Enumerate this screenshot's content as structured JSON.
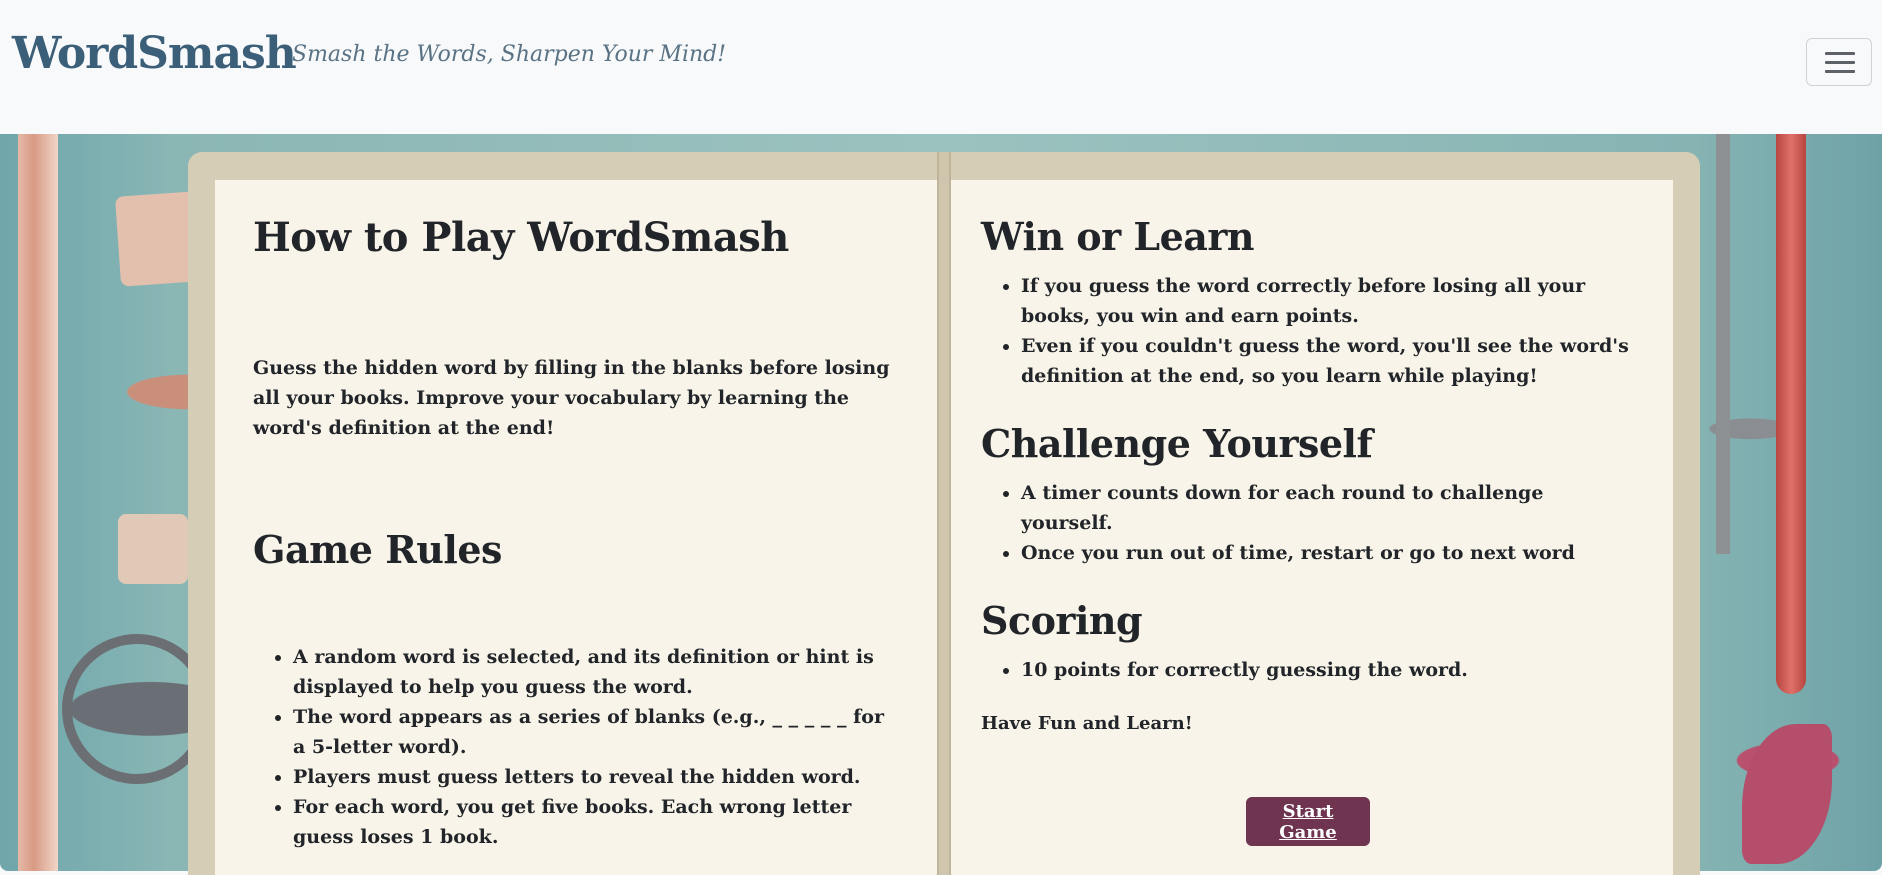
{
  "navbar": {
    "brand": "WordSmash",
    "tagline": "Smash the Words, Sharpen Your Mind!",
    "toggle_icon": "hamburger-menu-icon"
  },
  "colors": {
    "brand": "#3b5f78",
    "page": "#f8f4e9",
    "book_frame": "#d6cdb6",
    "button": "#6e3450"
  },
  "left_page": {
    "title": "How to Play WordSmash",
    "intro": "Guess the hidden word by filling in the blanks before losing all your books. Improve your vocabulary by learning the word's definition at the end!",
    "rules_title": "Game Rules",
    "rules": [
      "A random word is selected, and its definition or hint is displayed to help you guess the word.",
      "The word appears as a series of blanks (e.g., _ _ _ _ _ for a 5-letter word).",
      "Players must guess letters to reveal the hidden word.",
      "For each word, you get five books. Each wrong letter guess loses 1 book."
    ]
  },
  "right_page": {
    "win_title": "Win or Learn",
    "win_items": [
      "If you guess the word correctly before losing all your books, you win and earn points.",
      "Even if you couldn't guess the word, you'll see the word's definition at the end, so you learn while playing!"
    ],
    "challenge_title": "Challenge Yourself",
    "challenge_items": [
      "A timer counts down for each round to challenge yourself.",
      "Once you run out of time, restart or go to next word"
    ],
    "scoring_title": "Scoring",
    "scoring_items": [
      "10 points for correctly guessing the word."
    ],
    "closing": "Have Fun and Learn!",
    "start_button": "Start Game"
  }
}
